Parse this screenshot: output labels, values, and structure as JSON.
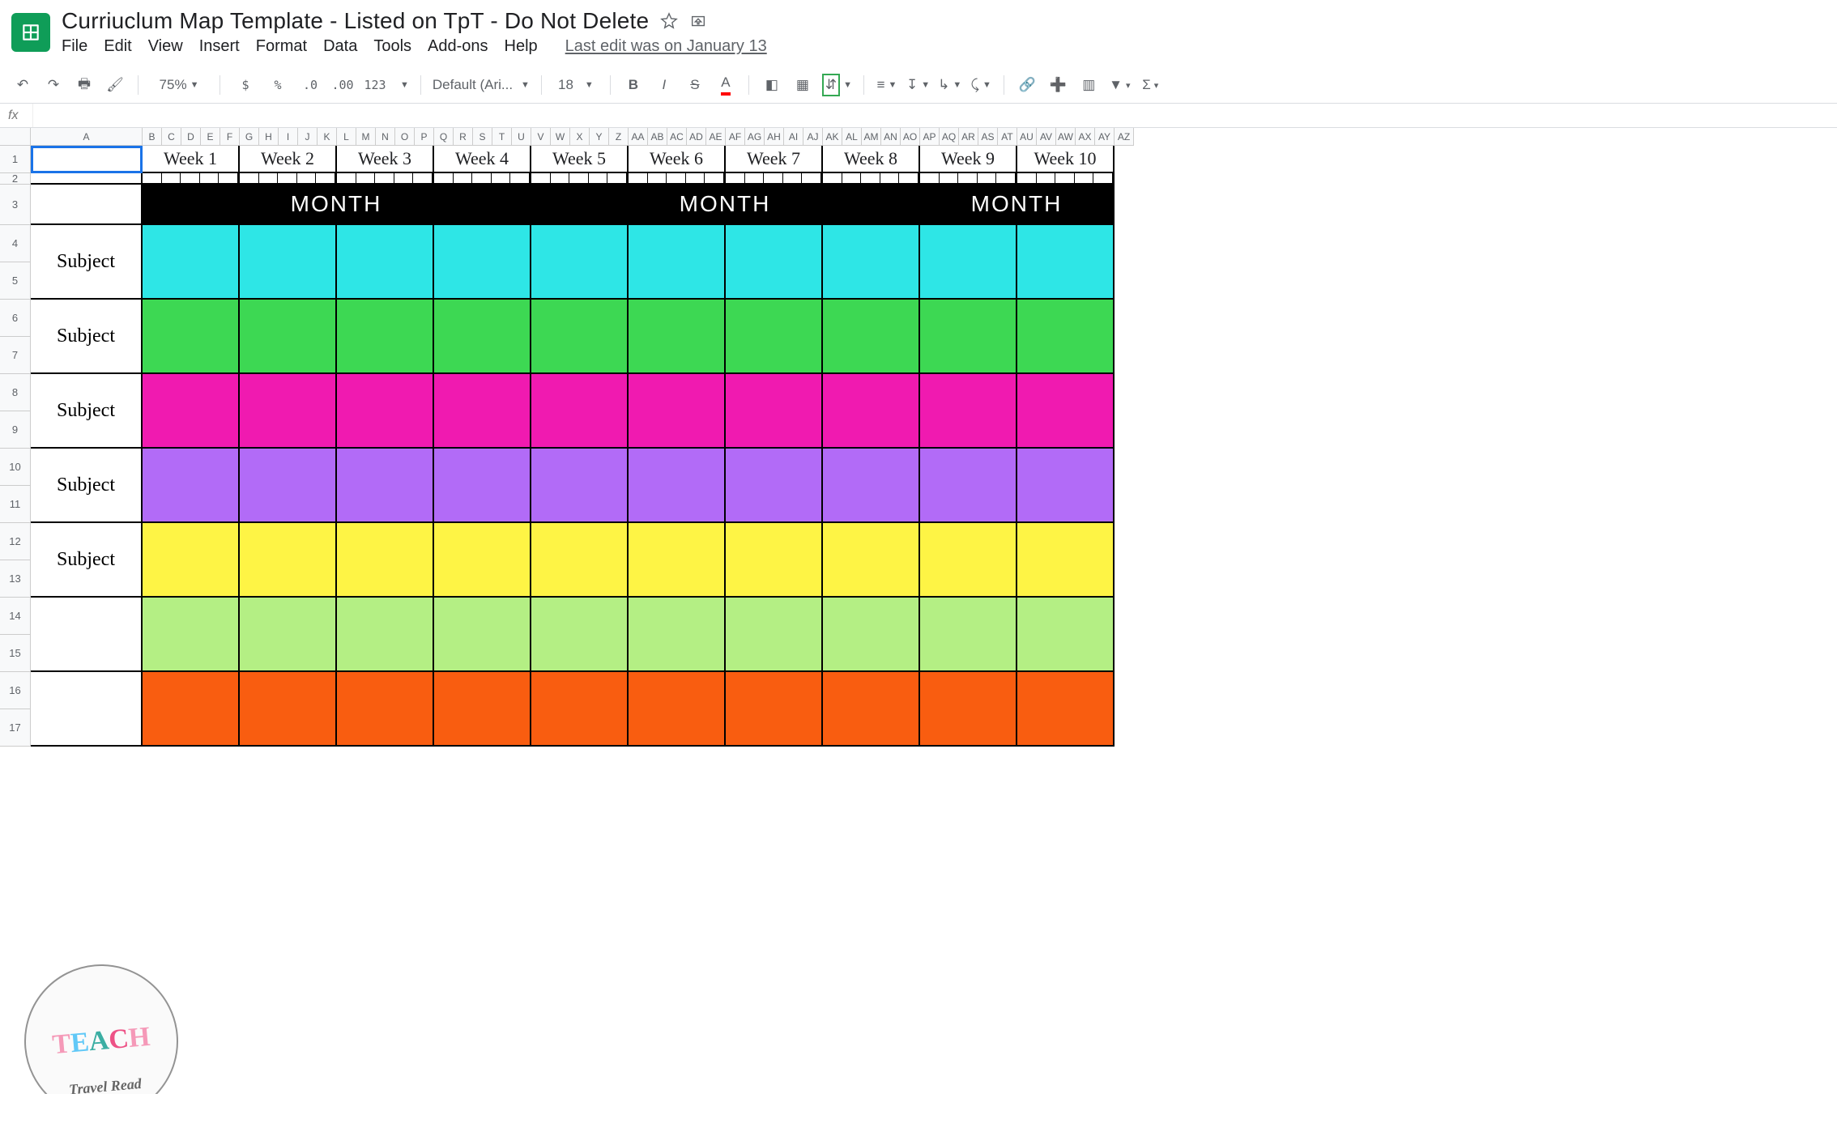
{
  "doc": {
    "title": "Curriuclum Map Template - Listed on TpT - Do Not Delete",
    "last_edit": "Last edit was on January 13"
  },
  "menus": [
    "File",
    "Edit",
    "View",
    "Insert",
    "Format",
    "Data",
    "Tools",
    "Add-ons",
    "Help"
  ],
  "toolbar": {
    "zoom": "75%",
    "font": "Default (Ari...",
    "font_size": "18",
    "num_btns": [
      "$",
      "%",
      ".0",
      ".00",
      "123"
    ]
  },
  "formula_bar": {
    "fx": "fx",
    "value": ""
  },
  "col_headers_first": "A",
  "col_headers_rest": [
    "B",
    "C",
    "D",
    "E",
    "F",
    "G",
    "H",
    "I",
    "J",
    "K",
    "L",
    "M",
    "N",
    "O",
    "P",
    "Q",
    "R",
    "S",
    "T",
    "U",
    "V",
    "W",
    "X",
    "Y",
    "Z",
    "AA",
    "AB",
    "AC",
    "AD",
    "AE",
    "AF",
    "AG",
    "AH",
    "AI",
    "AJ",
    "AK",
    "AL",
    "AM",
    "AN",
    "AO",
    "AP",
    "AQ",
    "AR",
    "AS",
    "AT",
    "AU",
    "AV",
    "AW",
    "AX",
    "AY",
    "AZ"
  ],
  "row_headers": [
    "1",
    "2",
    "3",
    "4",
    "5",
    "6",
    "7",
    "8",
    "9",
    "10",
    "11",
    "12",
    "13",
    "14",
    "15",
    "16",
    "17"
  ],
  "weeks": [
    "Week 1",
    "Week 2",
    "Week 3",
    "Week 4",
    "Week 5",
    "Week 6",
    "Week 7",
    "Week 8",
    "Week 9",
    "Week 10"
  ],
  "month_label": "MONTH",
  "subject_label": "Subject",
  "subjects_labeled": [
    "Subject",
    "Subject",
    "Subject",
    "Subject",
    "Subject",
    "",
    ""
  ],
  "row_colors": [
    "c-cyan",
    "c-green",
    "c-pink",
    "c-purple",
    "c-yellow",
    "c-lime",
    "c-orange"
  ],
  "watermark": {
    "text": "TEACH",
    "sub": "Travel  Read"
  }
}
